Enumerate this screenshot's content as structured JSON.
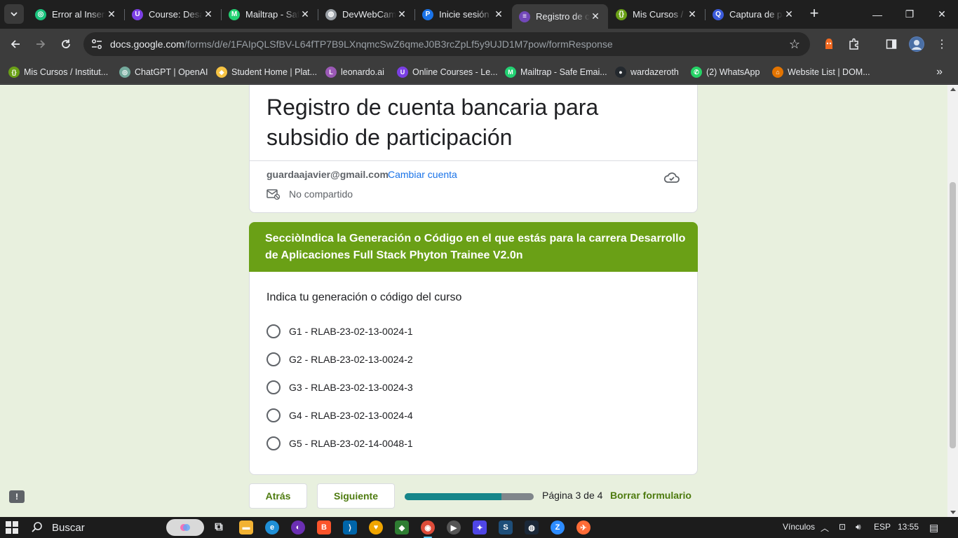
{
  "tabs": [
    {
      "title": "Error al Insertar",
      "color": "#19c37d",
      "glyph": "◎"
    },
    {
      "title": "Course: Desarrollo",
      "color": "#7b3fe4",
      "glyph": "U"
    },
    {
      "title": "Mailtrap - Safe",
      "color": "#22d172",
      "glyph": "M"
    },
    {
      "title": "DevWebCamp",
      "color": "#9aa0a6",
      "glyph": "◍"
    },
    {
      "title": "Inicie sesión",
      "color": "#1a73e8",
      "glyph": "P"
    },
    {
      "title": "Registro de cuenta",
      "color": "#7248b9",
      "glyph": "≡"
    },
    {
      "title": "Mis Cursos / Inst",
      "color": "#6aa016",
      "glyph": "{}"
    },
    {
      "title": "Captura de pantalla",
      "color": "#3b5bdb",
      "glyph": "Q"
    }
  ],
  "toolbar": {
    "url_host": "docs.google.com",
    "url_path": "/forms/d/e/1FAIpQLSfBV-L64fTP7B9LXnqmcSwZ6qmeJ0B3rcZpLf5y9UJD1M7pow/formResponse"
  },
  "bookmarks": [
    {
      "label": "Mis Cursos / Institut...",
      "color": "#6aa016",
      "glyph": "{}"
    },
    {
      "label": "ChatGPT | OpenAI",
      "color": "#74aa9c",
      "glyph": "◎"
    },
    {
      "label": "Student Home | Plat...",
      "color": "#f6c343",
      "glyph": "◆"
    },
    {
      "label": "leonardo.ai",
      "color": "#9b59b6",
      "glyph": "L"
    },
    {
      "label": "Online Courses - Le...",
      "color": "#7b3fe4",
      "glyph": "U"
    },
    {
      "label": "Mailtrap - Safe Emai...",
      "color": "#22d172",
      "glyph": "M"
    },
    {
      "label": "wardazeroth",
      "color": "#24292e",
      "glyph": "●"
    },
    {
      "label": "(2) WhatsApp",
      "color": "#25d366",
      "glyph": "✆"
    },
    {
      "label": "Website List | DOM...",
      "color": "#e37400",
      "glyph": "⌂"
    }
  ],
  "form": {
    "title": "Registro de cuenta bancaria para subsidio de participación",
    "email": "guardaajavier@gmail.com",
    "switch_account": "Cambiar cuenta",
    "not_shared": "No compartido",
    "section_title": "SecciòIndica la Generación o Código en el que estás para la carrera Desarrollo de Aplicaciones Full Stack Phyton Trainee V2.0n",
    "question": "Indica tu generación o código del curso",
    "options": [
      "G1 - RLAB-23-02-13-0024-1",
      "G2 - RLAB-23-02-13-0024-2",
      "G3 - RLAB-23-02-13-0024-3",
      "G4 - RLAB-23-02-13-0024-4",
      "G5 - RLAB-23-02-14-0048-1"
    ],
    "back": "Atrás",
    "next": "Siguiente",
    "progress_fraction": 0.75,
    "page_indicator": "Página 3 de 4",
    "clear": "Borrar formulario",
    "accent": "#6aa016",
    "progress_color": "#16868a"
  },
  "taskbar": {
    "search": "Buscar",
    "links": "Vínculos",
    "lang": "ESP",
    "time": "13:55"
  }
}
